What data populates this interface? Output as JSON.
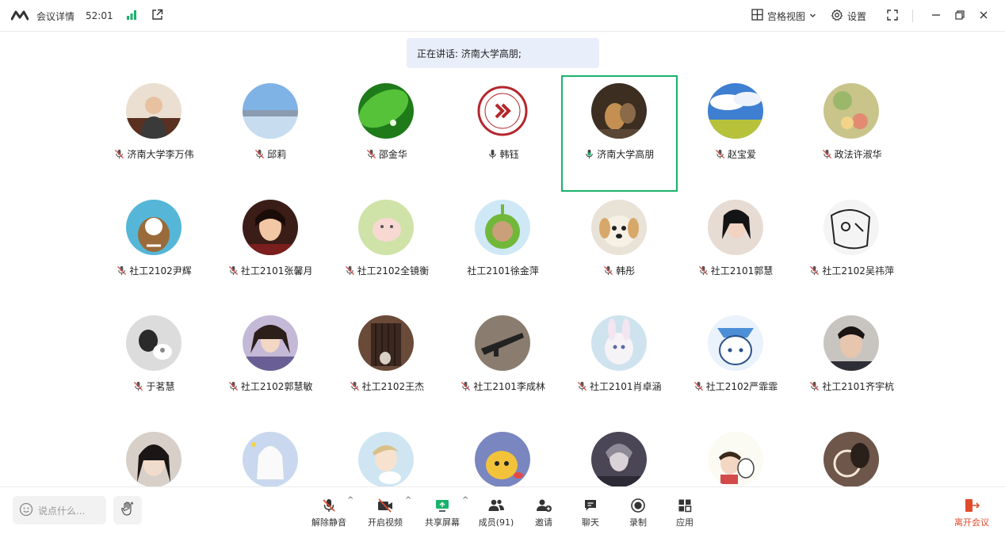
{
  "topbar": {
    "meeting_info": "会议详情",
    "timer": "52:01",
    "view_mode": "宫格视图",
    "settings": "设置"
  },
  "speaking": {
    "text": "正在讲话: 济南大学高朋;"
  },
  "participants": [
    {
      "name": "济南大学李万伟",
      "mic": "muted"
    },
    {
      "name": "邱莉",
      "mic": "muted"
    },
    {
      "name": "邵金华",
      "mic": "muted"
    },
    {
      "name": "韩钰",
      "mic": "on"
    },
    {
      "name": "济南大学高朋",
      "mic": "speaking",
      "active": true
    },
    {
      "name": "赵宝爱",
      "mic": "muted"
    },
    {
      "name": "政法许淑华",
      "mic": "muted"
    },
    {
      "name": "社工2102尹辉",
      "mic": "muted"
    },
    {
      "name": "社工2101张馨月",
      "mic": "muted"
    },
    {
      "name": "社工2102全镜衡",
      "mic": "muted"
    },
    {
      "name": "社工2101徐金萍",
      "mic": "none"
    },
    {
      "name": "韩彤",
      "mic": "muted"
    },
    {
      "name": "社工2101郭慧",
      "mic": "muted"
    },
    {
      "name": "社工2102吴祎萍",
      "mic": "muted"
    },
    {
      "name": "于茗慧",
      "mic": "muted"
    },
    {
      "name": "社工2102郭慧敏",
      "mic": "muted"
    },
    {
      "name": "社工2102王杰",
      "mic": "muted"
    },
    {
      "name": "社工2101李成林",
      "mic": "muted"
    },
    {
      "name": "社工2101肖卓涵",
      "mic": "muted"
    },
    {
      "name": "社工2102严霏霏",
      "mic": "muted"
    },
    {
      "name": "社工2101齐宇杭",
      "mic": "muted"
    },
    {
      "name": "",
      "mic": "none"
    },
    {
      "name": "",
      "mic": "none"
    },
    {
      "name": "",
      "mic": "none"
    },
    {
      "name": "",
      "mic": "none"
    },
    {
      "name": "",
      "mic": "none"
    },
    {
      "name": "",
      "mic": "none"
    },
    {
      "name": "",
      "mic": "none"
    }
  ],
  "bottombar": {
    "chat_placeholder": "说点什么...",
    "unmute": "解除静音",
    "start_video": "开启视频",
    "share_screen": "共享屏幕",
    "members": "成员(91)",
    "invite": "邀请",
    "chat": "聊天",
    "record": "录制",
    "apps": "应用",
    "leave": "离开会议"
  },
  "colors": {
    "accent_green": "#1ab26b",
    "leave_red": "#e14b2c",
    "speaking_bg": "#e9eefb",
    "muted_mic": "#d9534f"
  }
}
